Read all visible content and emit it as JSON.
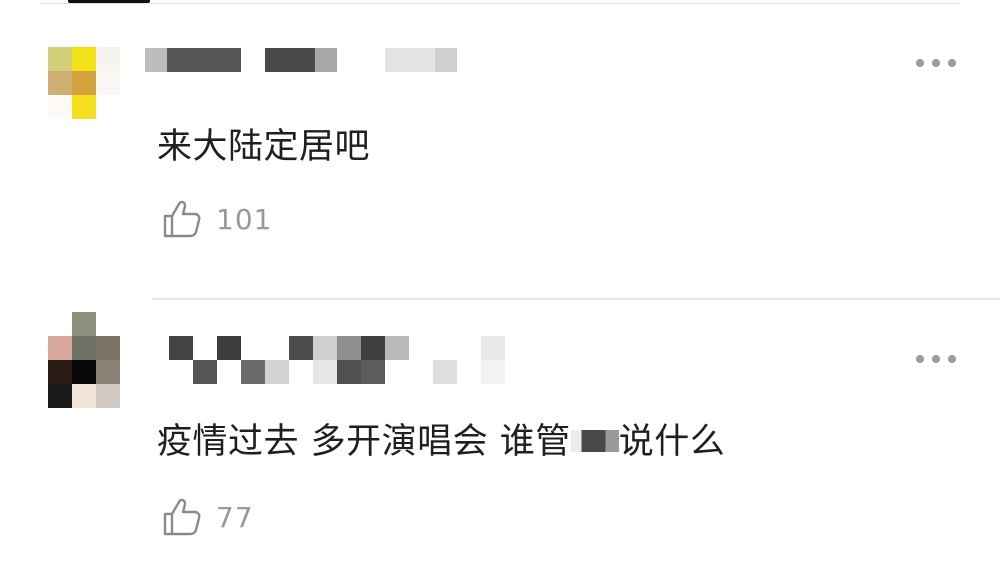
{
  "comments": [
    {
      "id": "comment-1",
      "text": "来大陆定居吧",
      "likes": "101",
      "like_icon": "thumbs-up-icon",
      "more_icon": "more-dots-icon",
      "username_redacted": true
    },
    {
      "id": "comment-2",
      "text_before": "疫情过去 多开演唱会 谁管",
      "text_after": "说什么",
      "likes": "77",
      "like_icon": "thumbs-up-icon",
      "more_icon": "more-dots-icon",
      "username_redacted": true
    }
  ],
  "colors": {
    "background": "#ffffff",
    "text": "#1f1f1f",
    "muted": "#999999",
    "divider": "#e5e5e5"
  }
}
